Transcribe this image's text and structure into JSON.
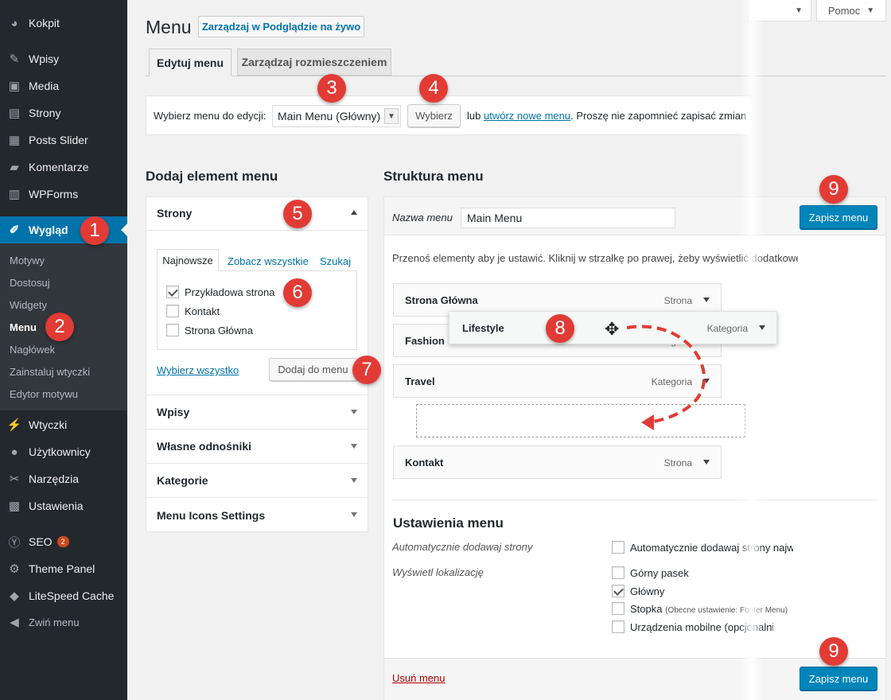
{
  "sidebar": {
    "items": [
      {
        "label": "Kokpit",
        "icon": "dashboard-icon",
        "glyph": "◕"
      },
      {
        "label": "Wpisy",
        "icon": "pin-icon",
        "glyph": "✎"
      },
      {
        "label": "Media",
        "icon": "media-icon",
        "glyph": "▣"
      },
      {
        "label": "Strony",
        "icon": "pages-icon",
        "glyph": "▤"
      },
      {
        "label": "Posts Slider",
        "icon": "slider-icon",
        "glyph": "▦"
      },
      {
        "label": "Komentarze",
        "icon": "comments-icon",
        "glyph": "▰"
      },
      {
        "label": "WPForms",
        "icon": "forms-icon",
        "glyph": "▥"
      },
      {
        "label": "Wygląd",
        "icon": "appearance-icon",
        "glyph": "✐"
      },
      {
        "label": "Wtyczki",
        "icon": "plugins-icon",
        "glyph": "⚡"
      },
      {
        "label": "Użytkownicy",
        "icon": "users-icon",
        "glyph": "●"
      },
      {
        "label": "Narzędzia",
        "icon": "tools-icon",
        "glyph": "✂"
      },
      {
        "label": "Ustawienia",
        "icon": "settings-icon",
        "glyph": "▩"
      },
      {
        "label": "SEO",
        "icon": "seo-icon",
        "glyph": "Ⓨ",
        "badge": "2"
      },
      {
        "label": "Theme Panel",
        "icon": "gear-icon",
        "glyph": "⚙"
      },
      {
        "label": "LiteSpeed Cache",
        "icon": "diamond-icon",
        "glyph": "◆"
      },
      {
        "label": "Zwiń menu",
        "icon": "collapse-icon",
        "glyph": "◀"
      }
    ],
    "submenu": [
      "Motywy",
      "Dostosuj",
      "Widgety",
      "Menu",
      "Nagłówek",
      "Zainstaluj wtyczki",
      "Edytor motywu"
    ]
  },
  "topbar": {
    "help": "Pomoc"
  },
  "header": {
    "title": "Menu",
    "live_button": "Zarządzaj w Podglądzie na żywo"
  },
  "tabs": [
    "Edytuj menu",
    "Zarządzaj rozmieszczeniem"
  ],
  "select_bar": {
    "label": "Wybierz menu do edycji:",
    "selected": "Main Menu (Główny)",
    "button": "Wybierz",
    "or": "lub",
    "create_link": "utwórz nowe menu",
    "note": ". Proszę nie zapomnieć zapisać zmian!"
  },
  "add_items": {
    "heading": "Dodaj element menu",
    "pages_title": "Strony",
    "subtabs": [
      "Najnowsze",
      "Zobacz wszystkie",
      "Szukaj"
    ],
    "pages": [
      "Przykładowa strona",
      "Kontakt",
      "Strona Główna"
    ],
    "select_all": "Wybierz wszystko",
    "add_button": "Dodaj do menu",
    "sections": [
      "Wpisy",
      "Własne odnośniki",
      "Kategorie",
      "Menu Icons Settings"
    ]
  },
  "structure": {
    "heading": "Struktura menu",
    "name_label": "Nazwa menu",
    "name_value": "Main Menu",
    "save_button": "Zapisz menu",
    "instructions": "Przenoś elementy aby je ustawić. Kliknij w strzałkę po prawej, żeby wyświetlić dodatkowe",
    "items": [
      {
        "label": "Strona Główna",
        "type": "Strona"
      },
      {
        "label": "Fashion",
        "type": "Kategoria"
      },
      {
        "label": "Travel",
        "type": "Kategoria"
      },
      {
        "label": "Kontakt",
        "type": "Strona"
      }
    ],
    "dragging": {
      "label": "Lifestyle",
      "type": "Kategoria"
    }
  },
  "settings": {
    "heading": "Ustawienia menu",
    "auto_label": "Automatycznie dodawaj strony",
    "auto_option": "Automatycznie dodawaj strony najwyższego poziomu",
    "location_label": "Wyświetl lokalizację",
    "locations": [
      {
        "label": "Górny pasek",
        "checked": false
      },
      {
        "label": "Główny",
        "checked": true
      },
      {
        "label": "Stopka",
        "note": "(Obecne ustawienie: Footer Menu)",
        "checked": false
      },
      {
        "label": "Urządzenia mobilne (opcjonalnie)",
        "checked": false
      }
    ],
    "delete_link": "Usuń menu"
  },
  "callouts": [
    "1",
    "2",
    "3",
    "4",
    "5",
    "6",
    "7",
    "8",
    "9",
    "9"
  ],
  "colors": {
    "sidebar": "#23282d",
    "accent": "#0073aa",
    "callout": "#e23b35",
    "primary_button": "#0085ba"
  }
}
